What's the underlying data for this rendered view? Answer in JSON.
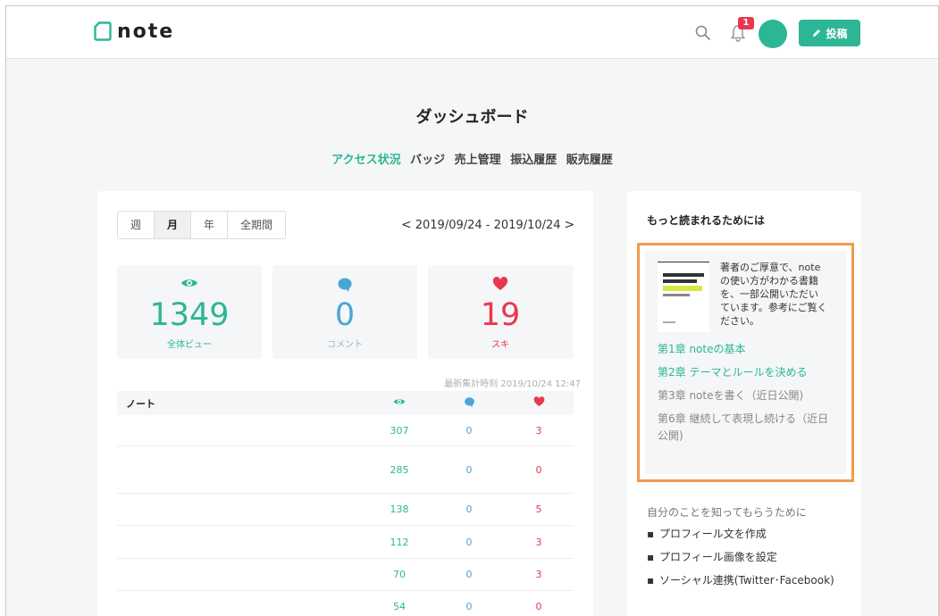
{
  "header": {
    "logo_text": "note",
    "notification_count": "1",
    "post_button_label": "投稿"
  },
  "page": {
    "title": "ダッシュボード",
    "tabs": [
      "アクセス状況",
      "バッジ",
      "売上管理",
      "振込履歴",
      "販売履歴"
    ],
    "active_tab": "アクセス状況"
  },
  "stats_panel": {
    "period_options": [
      "週",
      "月",
      "年",
      "全期間"
    ],
    "selected_period": "月",
    "date_range": "2019/09/24 - 2019/10/24",
    "prev_arrow": "<",
    "next_arrow": ">",
    "totals": {
      "views": {
        "value": "1349",
        "label": "全体ビュー"
      },
      "comments": {
        "value": "0",
        "label": "コメント"
      },
      "likes": {
        "value": "19",
        "label": "スキ"
      }
    },
    "last_updated": "最新集計時刻 2019/10/24 12:47",
    "table_header": "ノート",
    "rows": [
      {
        "views": "307",
        "comments": "0",
        "likes": "3"
      },
      {
        "views": "285",
        "comments": "0",
        "likes": "0"
      },
      {
        "views": "138",
        "comments": "0",
        "likes": "5"
      },
      {
        "views": "112",
        "comments": "0",
        "likes": "3"
      },
      {
        "views": "70",
        "comments": "0",
        "likes": "3"
      },
      {
        "views": "54",
        "comments": "0",
        "likes": "0"
      }
    ]
  },
  "sidebar": {
    "title": "もっと読まれるためには",
    "promo_text": "著者のご厚意で、noteの使い方がわかる書籍を、一部公開いただいています。参考にご覧ください。",
    "chapters": [
      {
        "label": "第1章 noteの基本",
        "link": true
      },
      {
        "label": "第2章 テーマとルールを決める",
        "link": true
      },
      {
        "label": "第3章 noteを書く（近日公開)",
        "link": false
      },
      {
        "label": "第6章 継続して表現し続ける（近日公開)",
        "link": false
      }
    ],
    "guide_title": "自分のことを知ってもらうために",
    "guide_items": [
      "プロフィール文を作成",
      "プロフィール画像を設定",
      "ソーシャル連携(Twitter･Facebook)"
    ]
  },
  "colors": {
    "accent": "#2cb696",
    "comment_blue": "#4aa6d6",
    "like_red": "#e8384f",
    "highlight_border": "#f39a4e"
  }
}
